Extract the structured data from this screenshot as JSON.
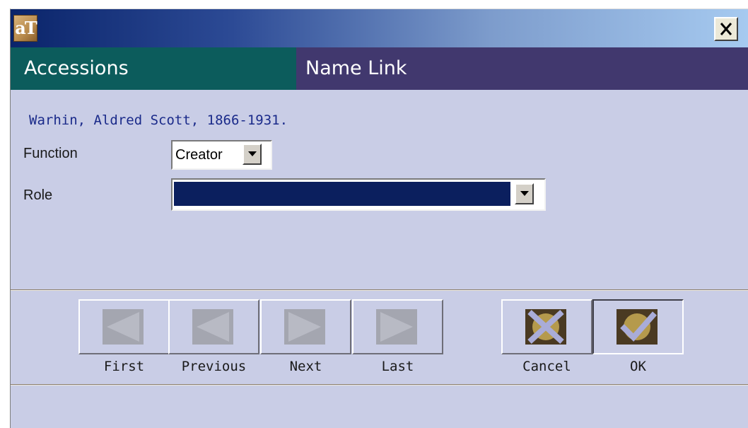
{
  "window": {
    "app_icon_text": "aT",
    "close_icon": "close-icon"
  },
  "header": {
    "left_title": "Accessions",
    "right_title": "Name Link"
  },
  "record": {
    "name": "Warhin, Aldred Scott, 1866-1931."
  },
  "form": {
    "function_label": "Function",
    "function_value": "Creator",
    "role_label": "Role",
    "role_value": ""
  },
  "buttons": {
    "first": "First",
    "previous": "Previous",
    "next": "Next",
    "last": "Last",
    "cancel": "Cancel",
    "ok": "OK"
  },
  "colors": {
    "header_left_bg": "#0c5c5c",
    "header_right_bg": "#41386e",
    "panel_bg": "#c9cde6",
    "name_text": "#1a2a8a",
    "role_selected_bg": "#0b1f5e"
  }
}
